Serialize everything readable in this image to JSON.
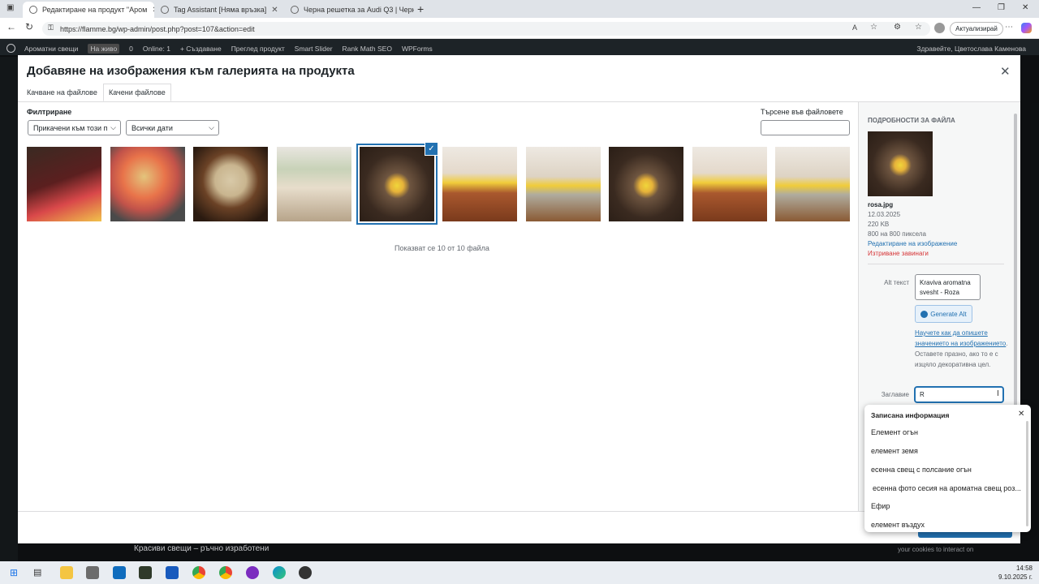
{
  "browser": {
    "tabs": [
      {
        "label": "Редактиране на продукт \"Аром"
      },
      {
        "label": "Tag Assistant [Няма връзка]"
      },
      {
        "label": "Черна решетка за Audi Q3 | Черн"
      }
    ],
    "url": "https://flamme.bg/wp-admin/post.php?post=107&action=edit",
    "update_label": "Актуализирай"
  },
  "adminbar": {
    "items": [
      "Ароматни свещи",
      "На живо",
      "0",
      "Online: 1",
      "+ Създаване",
      "Преглед продукт",
      "Smart Slider",
      "Rank Math SEO",
      "WPForms"
    ],
    "greeting": "Здравейте, Цветослава Каменова"
  },
  "modal": {
    "title": "Добавяне на изображения към галерията на продукта",
    "tabs": [
      "Качване на файлове",
      "Качени файлове"
    ],
    "filter_label": "Филтриране",
    "filter_select": "Прикачени към този п",
    "date_select": "Всички дати",
    "search_label": "Търсене във файловете",
    "count_text": "Показват се 10 от 10 файла"
  },
  "details": {
    "heading": "Подробности за файла",
    "filename": "rosa.jpg",
    "date": "12.03.2025",
    "size": "220 KB",
    "dimensions": "800 на 800 пиксела",
    "edit_link": "Редактиране на изображение",
    "delete_link": "Изтриване завинаги",
    "alt_label": "Alt текст",
    "alt_value": "Kraviva aromatna svesht - Roza",
    "generate_alt": "Generate Alt",
    "alt_help_link": "Научете как да опишете значението на изображението",
    "alt_help_text": ". Оставете празно, ако то е с изцяло декоративна цел.",
    "title_label": "Заглавие",
    "title_value": "R"
  },
  "autofill": {
    "heading": "Записана информация",
    "items": [
      "Елемент огън",
      "елемент земя",
      "есенна свещ с полсание огън",
      "есенна фото сесия на ароматна свещ роз...",
      "Ефир",
      "елемент въздух"
    ]
  },
  "behind": {
    "left_text": "Красиви свещи – ръчно изработени",
    "right_text": "your cookies to interact on"
  },
  "clock": {
    "time": "14:58",
    "date": "9.10.2025 г."
  },
  "colors": {
    "accent": "#2271b1",
    "danger": "#d63638"
  }
}
